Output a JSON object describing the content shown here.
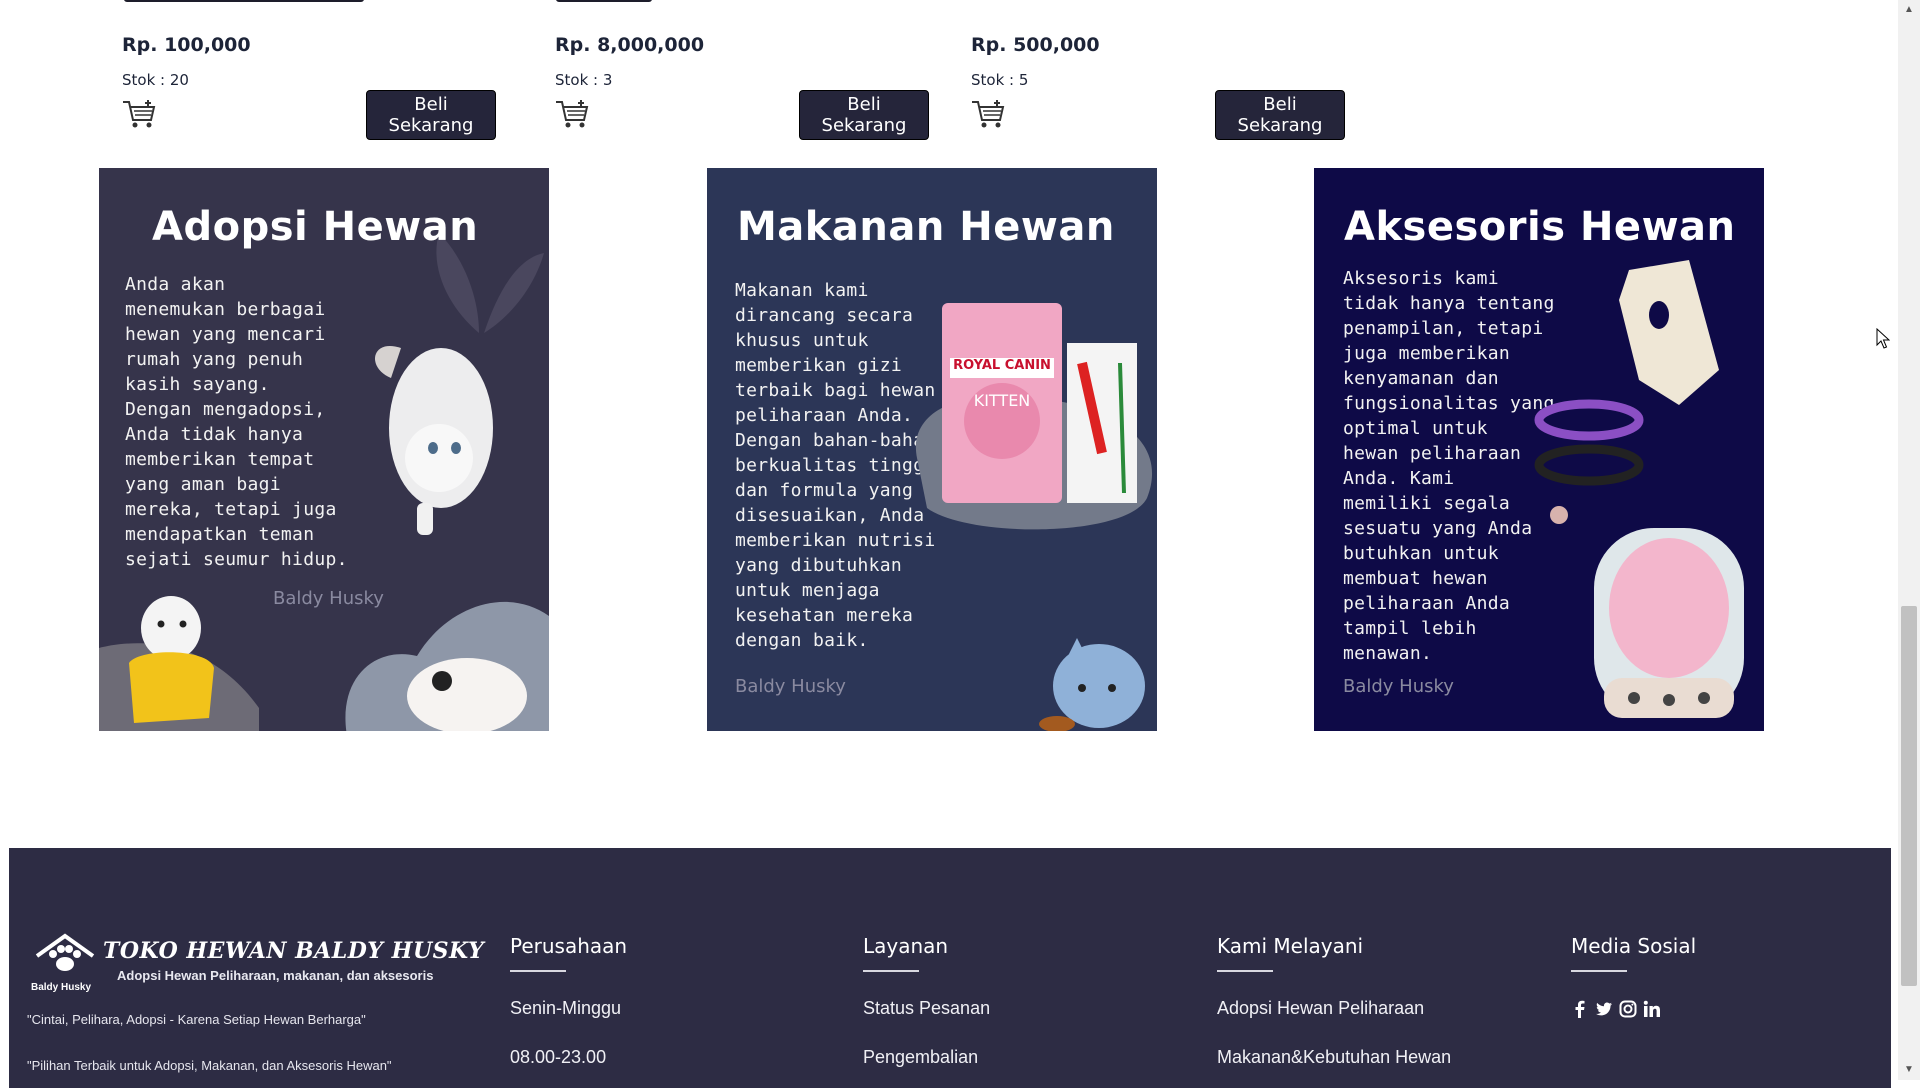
{
  "products": [
    {
      "price": "Rp. 100,000",
      "stock": "Stok : 20",
      "buy_label": "Beli Sekarang"
    },
    {
      "price": "Rp. 8,000,000",
      "stock": "Stok : 3",
      "buy_label": "Beli Sekarang"
    },
    {
      "price": "Rp. 500,000",
      "stock": "Stok : 5",
      "buy_label": "Beli Sekarang"
    }
  ],
  "banners": [
    {
      "title": "Adopsi Hewan",
      "text": "Anda akan\nmenemukan berbagai\nhewan yang mencari\nrumah yang penuh\nkasih sayang.\nDengan mengadopsi,\nAnda tidak hanya\nmemberikan tempat\nyang aman bagi\nmereka, tetapi juga\nmendapatkan teman\nsejati seumur hidup.",
      "watermark": "Baldy Husky",
      "bg": "#36344b"
    },
    {
      "title": "Makanan Hewan",
      "text": "Makanan kami\ndirancang secara\nkhusus untuk\nmemberikan gizi\nterbaik bagi hewan\npeliharaan Anda.\nDengan bahan-bahan\nberkualitas tinggi\ndan formula yang\ndisesuaikan,  Anda\nmemberikan nutrisi\nyang dibutuhkan\nuntuk menjaga\nkesehatan mereka\ndengan baik.",
      "watermark": "Baldy Husky",
      "bg": "#2c3657",
      "pack_brand": "ROYAL CANIN",
      "pack_label": "KITTEN"
    },
    {
      "title": "Aksesoris Hewan",
      "text": "Aksesoris kami\ntidak hanya tentang\npenampilan, tetapi\njuga memberikan\nkenyamanan dan\nfungsionalitas yang\noptimal untuk\nhewan peliharaan\nAnda. Kami\nmemiliki segala\nsesuatu yang Anda\nbutuhkan untuk\nmembuat hewan\npeliharaan Anda\ntampil lebih\nmenawan.",
      "watermark": "Baldy Husky",
      "bg": "#0e0a47"
    }
  ],
  "footer": {
    "logo_title": "TOKO HEWAN BALDY HUSKY",
    "logo_subtitle": "Adopsi Hewan Peliharaan, makanan, dan aksesoris",
    "logo_brand": "Baldy Husky",
    "quote1": "\"Cintai, Pelihara, Adopsi - Karena Setiap Hewan Berharga\"",
    "quote2": "\"Pilihan Terbaik untuk Adopsi, Makanan, dan Aksesoris Hewan\"",
    "columns": [
      {
        "heading": "Perusahaan",
        "items": [
          "Senin-Minggu",
          "08.00-23.00"
        ]
      },
      {
        "heading": "Layanan",
        "items": [
          "Status Pesanan",
          "Pengembalian"
        ]
      },
      {
        "heading": "Kami Melayani",
        "items": [
          "Adopsi Hewan Peliharaan",
          "Makanan&Kebutuhan Hewan"
        ]
      },
      {
        "heading": "Media Sosial",
        "icons": [
          "facebook-icon",
          "twitter-icon",
          "instagram-icon",
          "linkedin-icon"
        ]
      }
    ]
  }
}
